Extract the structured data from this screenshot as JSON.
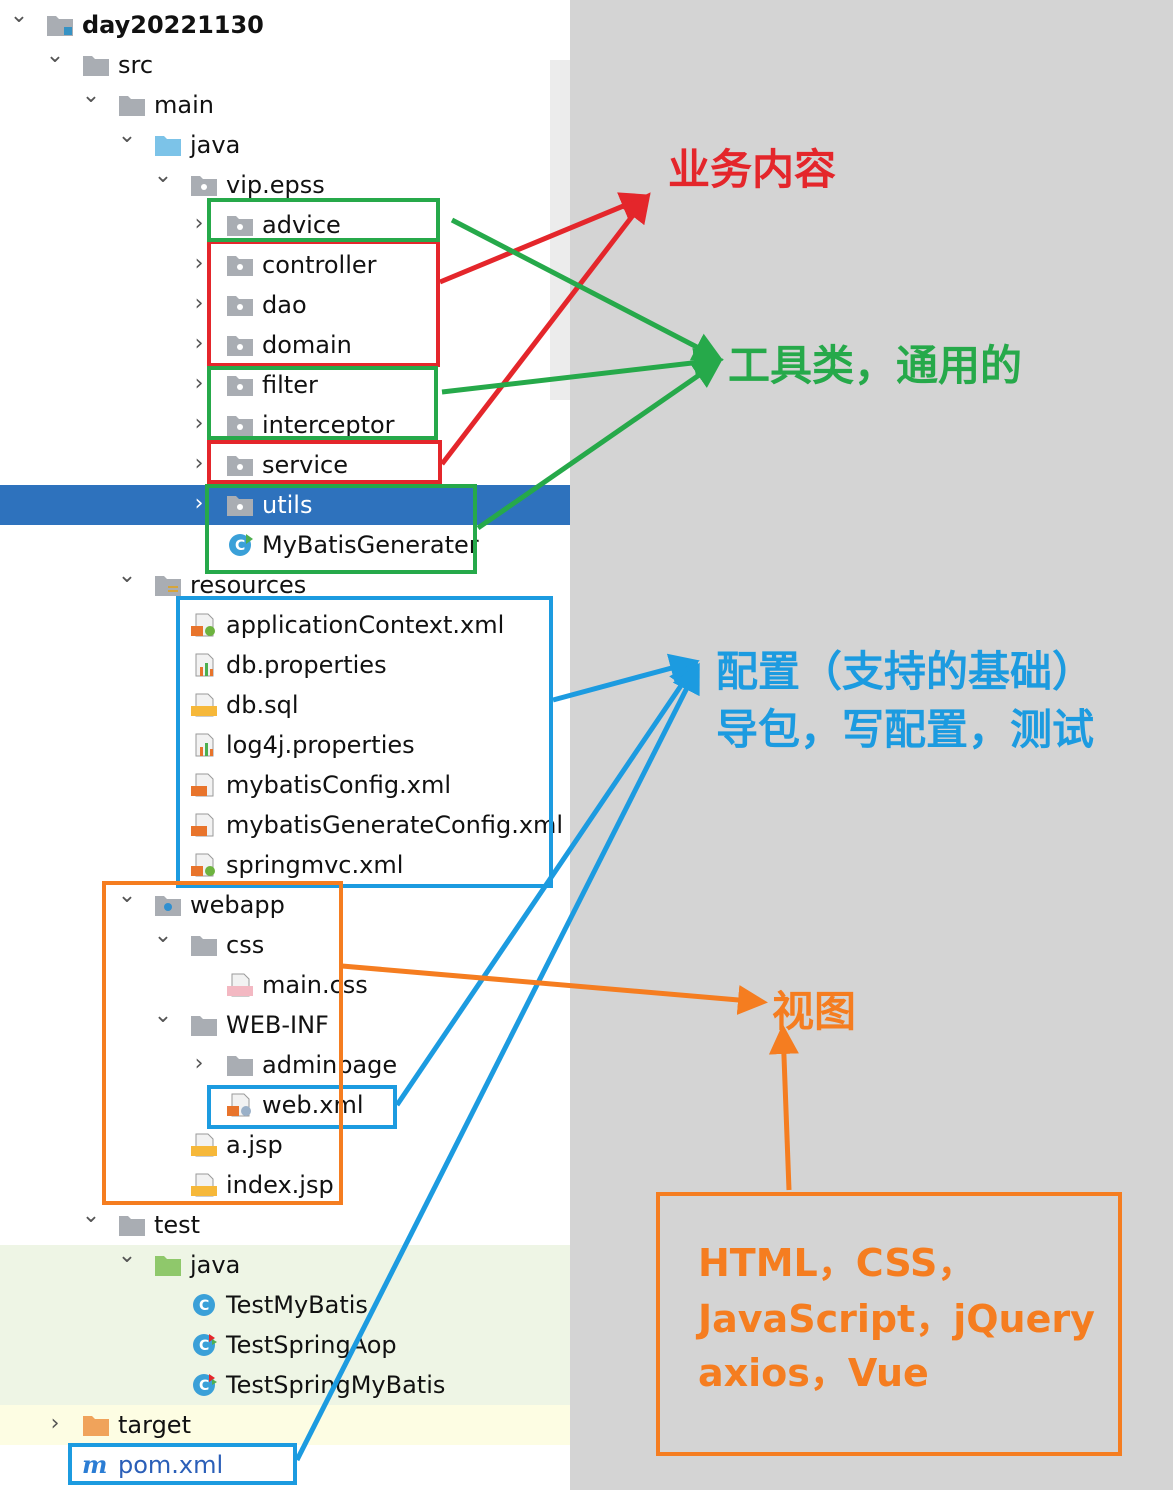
{
  "tree": [
    {
      "label": "day20221130",
      "icon": "module-folder-icon",
      "chevron": "expanded",
      "depth": 0,
      "bold": true
    },
    {
      "label": "src",
      "icon": "folder-icon",
      "chevron": "expanded",
      "depth": 1
    },
    {
      "label": "main",
      "icon": "folder-icon",
      "chevron": "expanded",
      "depth": 2
    },
    {
      "label": "java",
      "icon": "source-root-folder-icon",
      "chevron": "expanded",
      "depth": 3
    },
    {
      "label": "vip.epss",
      "icon": "package-icon",
      "chevron": "expanded",
      "depth": 4
    },
    {
      "label": "advice",
      "icon": "package-icon",
      "chevron": "collapsed",
      "depth": 5
    },
    {
      "label": "controller",
      "icon": "package-icon",
      "chevron": "collapsed",
      "depth": 5
    },
    {
      "label": "dao",
      "icon": "package-icon",
      "chevron": "collapsed",
      "depth": 5
    },
    {
      "label": "domain",
      "icon": "package-icon",
      "chevron": "collapsed",
      "depth": 5
    },
    {
      "label": "filter",
      "icon": "package-icon",
      "chevron": "collapsed",
      "depth": 5
    },
    {
      "label": "interceptor",
      "icon": "package-icon",
      "chevron": "collapsed",
      "depth": 5
    },
    {
      "label": "service",
      "icon": "package-icon",
      "chevron": "collapsed",
      "depth": 5
    },
    {
      "label": "utils",
      "icon": "package-icon",
      "chevron": "collapsed",
      "depth": 5,
      "selected": true
    },
    {
      "label": "MyBatisGenerater",
      "icon": "runnable-class-icon",
      "chevron": "none",
      "depth": 5
    },
    {
      "label": "resources",
      "icon": "resources-folder-icon",
      "chevron": "expanded",
      "depth": 3
    },
    {
      "label": "applicationContext.xml",
      "icon": "spring-xml-file-icon",
      "chevron": "none",
      "depth": 4
    },
    {
      "label": "db.properties",
      "icon": "properties-file-icon",
      "chevron": "none",
      "depth": 4
    },
    {
      "label": "db.sql",
      "icon": "sql-file-icon",
      "chevron": "none",
      "depth": 4
    },
    {
      "label": "log4j.properties",
      "icon": "properties-file-icon",
      "chevron": "none",
      "depth": 4
    },
    {
      "label": "mybatisConfig.xml",
      "icon": "xml-file-icon",
      "chevron": "none",
      "depth": 4
    },
    {
      "label": "mybatisGenerateConfig.xml",
      "icon": "xml-file-icon",
      "chevron": "none",
      "depth": 4
    },
    {
      "label": "springmvc.xml",
      "icon": "spring-xml-file-icon",
      "chevron": "none",
      "depth": 4
    },
    {
      "label": "webapp",
      "icon": "web-folder-icon",
      "chevron": "expanded",
      "depth": 3
    },
    {
      "label": "css",
      "icon": "folder-icon",
      "chevron": "expanded",
      "depth": 4
    },
    {
      "label": "main.css",
      "icon": "css-file-icon",
      "chevron": "none",
      "depth": 5
    },
    {
      "label": "WEB-INF",
      "icon": "folder-icon",
      "chevron": "expanded",
      "depth": 4
    },
    {
      "label": "adminpage",
      "icon": "folder-icon",
      "chevron": "collapsed",
      "depth": 5
    },
    {
      "label": "web.xml",
      "icon": "web-xml-file-icon",
      "chevron": "none",
      "depth": 5
    },
    {
      "label": "a.jsp",
      "icon": "jsp-file-icon",
      "chevron": "none",
      "depth": 4
    },
    {
      "label": "index.jsp",
      "icon": "jsp-file-icon",
      "chevron": "none",
      "depth": 4
    },
    {
      "label": "test",
      "icon": "folder-icon",
      "chevron": "expanded",
      "depth": 2
    },
    {
      "label": "java",
      "icon": "test-root-folder-icon",
      "chevron": "expanded",
      "depth": 3,
      "bg": "test"
    },
    {
      "label": "TestMyBatis",
      "icon": "class-icon",
      "chevron": "none",
      "depth": 4,
      "bg": "test"
    },
    {
      "label": "TestSpringAop",
      "icon": "test-class-icon",
      "chevron": "none",
      "depth": 4,
      "bg": "test"
    },
    {
      "label": "TestSpringMyBatis",
      "icon": "test-class-icon",
      "chevron": "none",
      "depth": 4,
      "bg": "test"
    },
    {
      "label": "target",
      "icon": "excluded-folder-icon",
      "chevron": "collapsed",
      "depth": 1,
      "bg": "excluded"
    },
    {
      "label": "pom.xml",
      "icon": "maven-icon",
      "chevron": "none",
      "depth": 1,
      "pom": true
    }
  ],
  "annotations": {
    "business": "业务内容",
    "tools": "工具类，通用的",
    "config_line1": "配置（支持的基础）",
    "config_line2": "导包，写配置，测试",
    "view": "视图"
  },
  "tech_box": {
    "line1": "HTML，CSS，",
    "line2": "JavaScript，jQuery",
    "line3": "axios，Vue"
  },
  "colors": {
    "business": "#e4262b",
    "tools": "#26a94a",
    "config": "#1c9be0",
    "view": "#f57d20",
    "selection": "#2e72bd"
  }
}
